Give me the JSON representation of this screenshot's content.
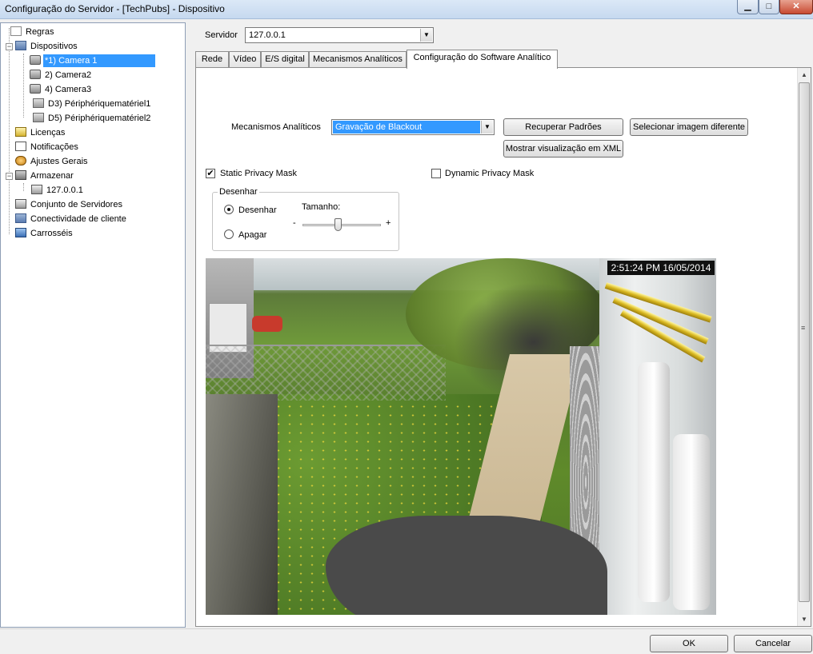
{
  "window": {
    "title": "Configuração do Servidor - [TechPubs] - Dispositivo",
    "minimize": "▁",
    "maximize": "□",
    "close": "✕"
  },
  "tree": {
    "items": [
      {
        "label": "Regras",
        "icon": "rules-icon"
      },
      {
        "label": "Dispositivos",
        "icon": "network-icon"
      },
      {
        "label": "*1) Camera 1",
        "icon": "camera-icon",
        "selected": true
      },
      {
        "label": "2) Camera2",
        "icon": "camera-icon"
      },
      {
        "label": "4) Camera3",
        "icon": "camera-icon"
      },
      {
        "label": "D3) Périphériquematériel1",
        "icon": "hardware-icon"
      },
      {
        "label": "D5) Périphériquematériel2",
        "icon": "hardware-icon"
      },
      {
        "label": "Licenças",
        "icon": "license-icon"
      },
      {
        "label": "Notificações",
        "icon": "notification-icon"
      },
      {
        "label": "Ajustes Gerais",
        "icon": "settings-icon"
      },
      {
        "label": "Armazenar",
        "icon": "storage-icon"
      },
      {
        "label": "127.0.0.1",
        "icon": "server-icon"
      },
      {
        "label": "Conjunto de Servidores",
        "icon": "server-group-icon"
      },
      {
        "label": "Conectividade de cliente",
        "icon": "client-icon"
      },
      {
        "label": "Carrosséis",
        "icon": "monitor-icon"
      }
    ],
    "expand_minus": "−"
  },
  "server": {
    "label": "Servidor",
    "value": "127.0.0.1"
  },
  "tabs": [
    {
      "label": "Rede"
    },
    {
      "label": "Vídeo"
    },
    {
      "label": "E/S digital"
    },
    {
      "label": "Mecanismos Analíticos"
    },
    {
      "label": "Configuração do Software Analítico",
      "active": true
    }
  ],
  "analytics": {
    "engine_label": "Mecanismos Analíticos",
    "engine_value": "Gravação de Blackout",
    "restore_button": "Recuperar Padrões",
    "select_image_button": "Selecionar imagem diferente",
    "xml_button": "Mostrar visualização em XML",
    "static_mask_label": "Static Privacy Mask",
    "static_mask_checked": true,
    "dynamic_mask_label": "Dynamic Privacy Mask",
    "dynamic_mask_checked": false,
    "checkmark": "✔"
  },
  "draw_group": {
    "legend": "Desenhar",
    "draw_label": "Desenhar",
    "erase_label": "Apagar",
    "size_label": "Tamanho:",
    "minus": "-",
    "plus": "+",
    "size_value": 0.45,
    "mode": "draw"
  },
  "camera": {
    "timestamp": "2:51:24 PM 16/05/2014"
  },
  "scrollbar": {
    "up": "▲",
    "down": "▼",
    "grip": "≡"
  },
  "footer": {
    "ok": "OK",
    "cancel": "Cancelar"
  }
}
